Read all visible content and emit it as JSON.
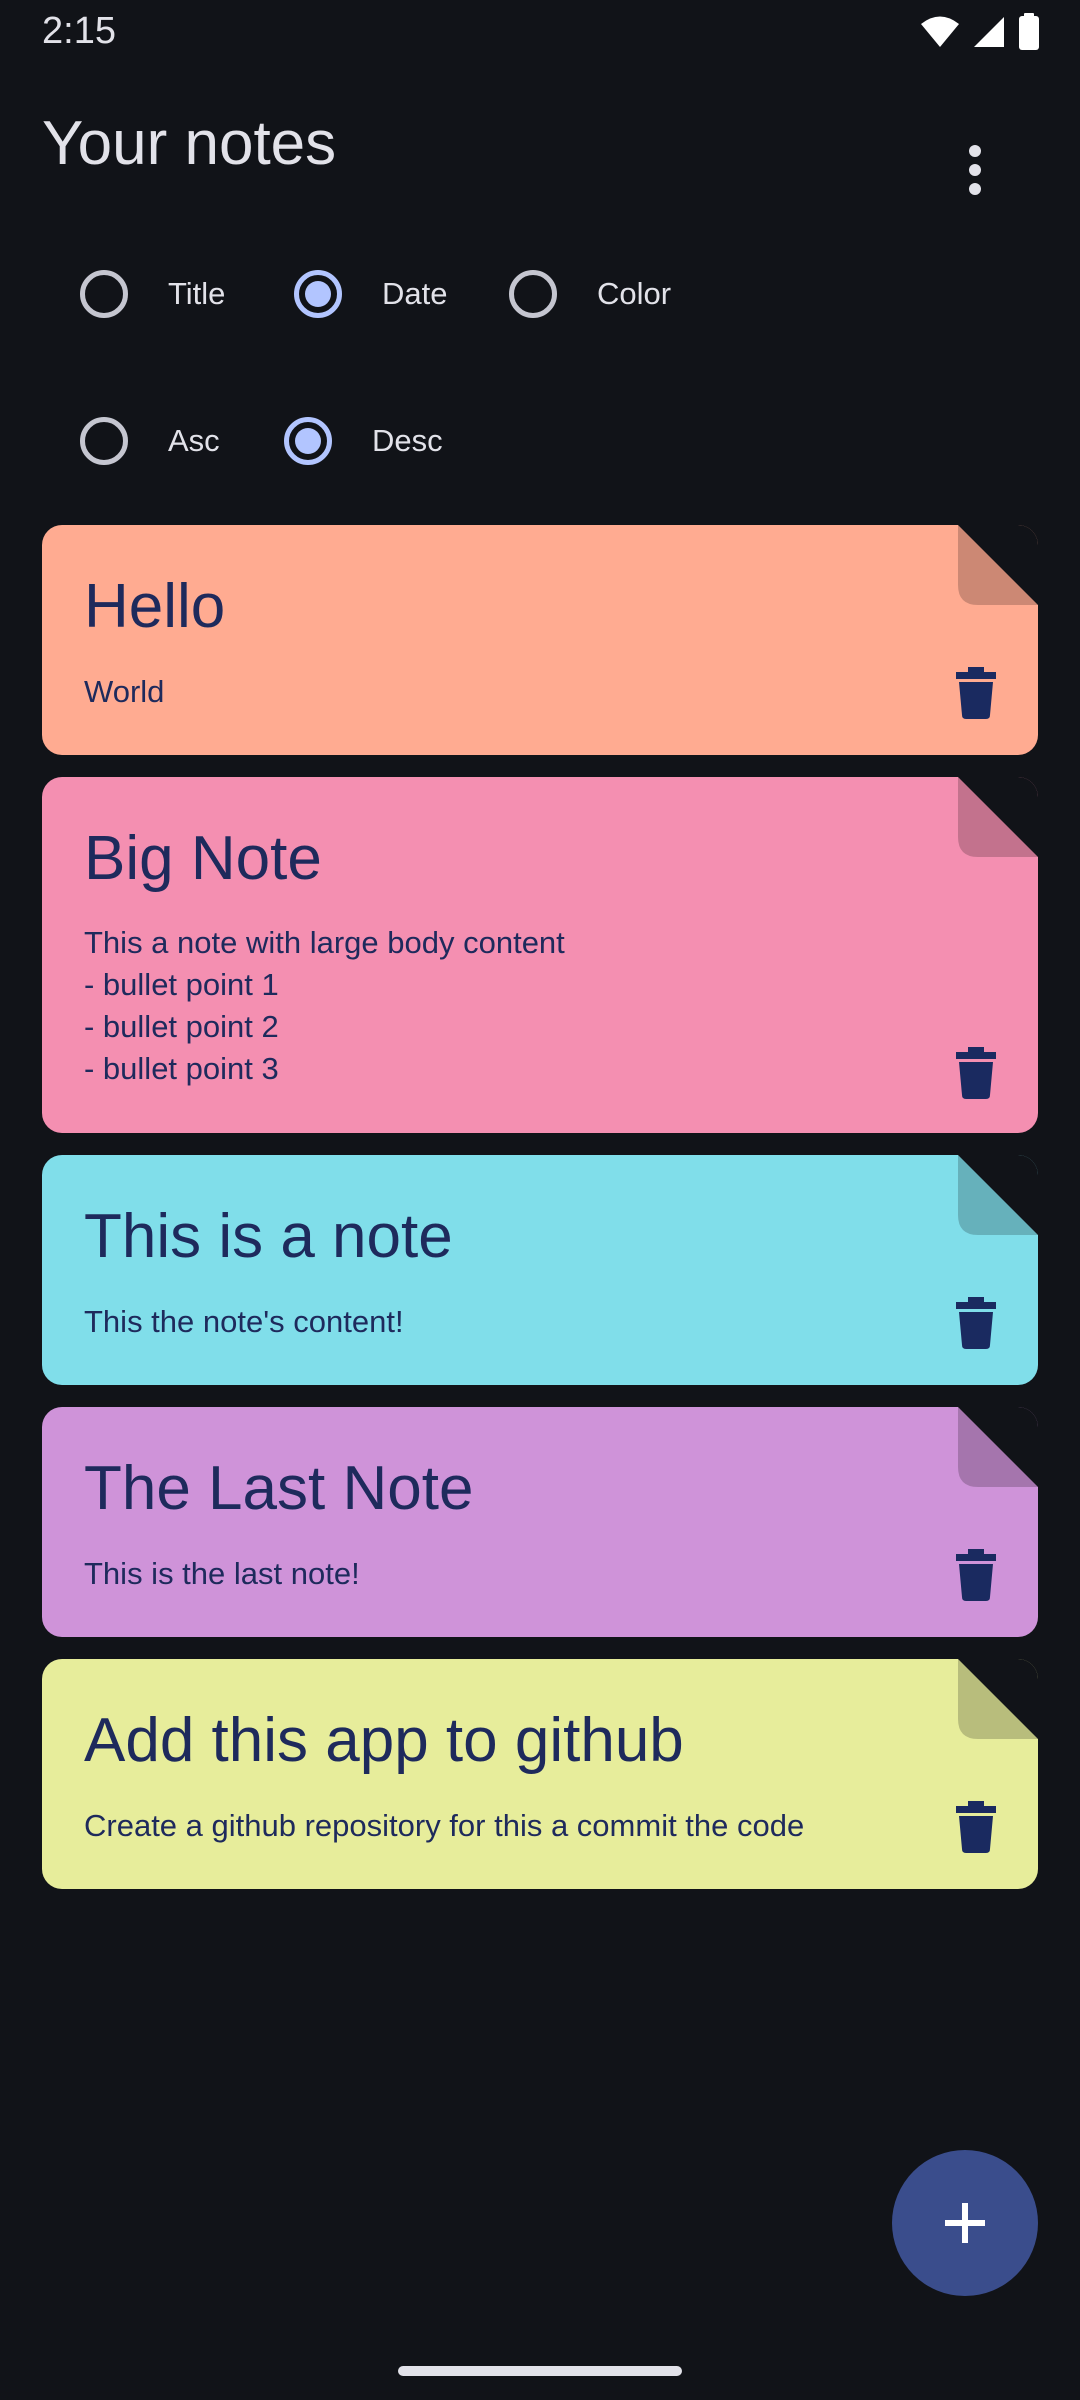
{
  "status_bar": {
    "time": "2:15",
    "icons": [
      "wifi-icon",
      "signal-icon",
      "battery-icon"
    ]
  },
  "header": {
    "title": "Your notes",
    "menu_icon": "more-vert-icon"
  },
  "sort_by": {
    "options": [
      {
        "label": "Title",
        "selected": false
      },
      {
        "label": "Date",
        "selected": true
      },
      {
        "label": "Color",
        "selected": false
      }
    ]
  },
  "order": {
    "options": [
      {
        "label": "Asc",
        "selected": false
      },
      {
        "label": "Desc",
        "selected": true
      }
    ]
  },
  "notes": [
    {
      "title": "Hello",
      "content": "World",
      "color": "#ffab91"
    },
    {
      "title": "Big Note",
      "content": "This a note with large body content\n- bullet point 1\n- bullet point 2\n- bullet point 3",
      "color": "#f48fb1"
    },
    {
      "title": "This is a note",
      "content": "This the note's content!",
      "color": "#80deea"
    },
    {
      "title": "The Last Note",
      "content": "This is the last note!",
      "color": "#cf93d9"
    },
    {
      "title": "Add this app to github",
      "content": "Create a github repository for this a commit the code",
      "color": "#e7ed9b"
    }
  ],
  "fab": {
    "icon": "add-icon"
  },
  "colors": {
    "background": "#111318",
    "text_on_note": "#1e2a5c",
    "radio_selected": "#b2c5ff",
    "fab": "#3a4d8c"
  }
}
